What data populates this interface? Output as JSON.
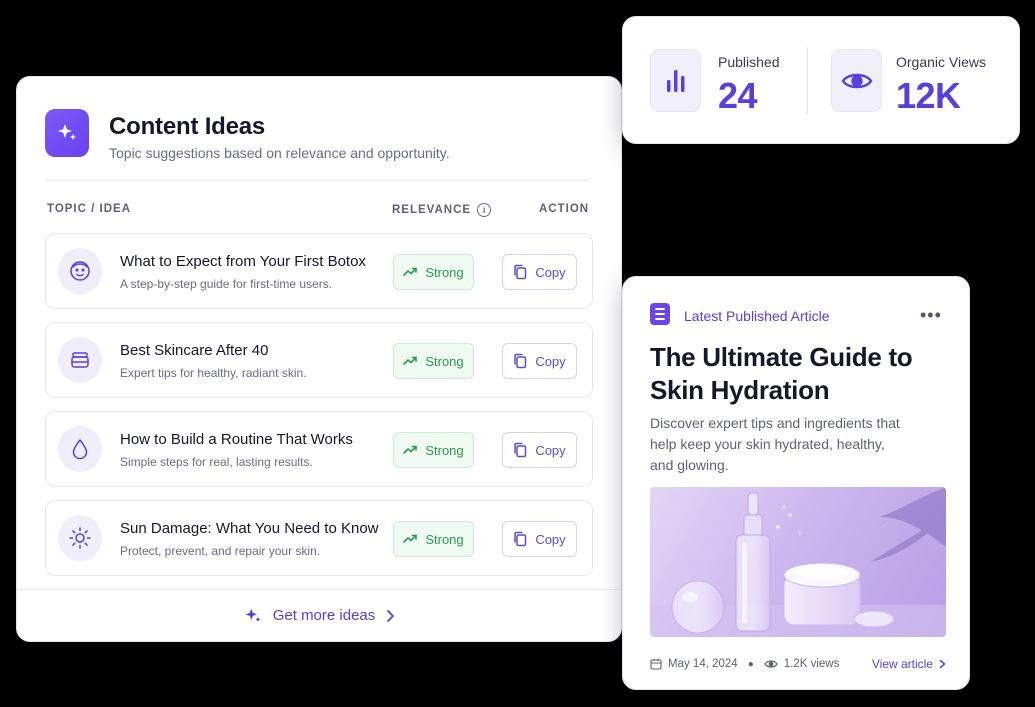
{
  "ideas": {
    "title": "Content Ideas",
    "subtitle": "Topic suggestions based on relevance and opportunity.",
    "columns": {
      "topic": "TOPIC / IDEA",
      "relevance": "RELEVANCE",
      "action": "ACTION"
    },
    "rows": [
      {
        "icon": "face-icon",
        "title": "What to Expect from Your First Botox",
        "desc": "A step-by-step guide for first-time users.",
        "relevance": "Strong",
        "action": "Copy"
      },
      {
        "icon": "jar-icon",
        "title": "Best Skincare After 40",
        "desc": "Expert tips for healthy, radiant skin.",
        "relevance": "Strong",
        "action": "Copy"
      },
      {
        "icon": "drop-icon",
        "title": "How to Build a Routine That Works",
        "desc": "Simple steps for real, lasting results.",
        "relevance": "Strong",
        "action": "Copy"
      },
      {
        "icon": "sun-icon",
        "title": "Sun Damage: What You Need to Know",
        "desc": "Protect, prevent, and repair your skin.",
        "relevance": "Strong",
        "action": "Copy"
      }
    ],
    "footer_label": "Get more ideas"
  },
  "stats": {
    "published_label": "Published",
    "published_value": "24",
    "views_label": "Organic Views",
    "views_value": "12K"
  },
  "article": {
    "kicker": "Latest Published Article",
    "title": "The Ultimate Guide to Skin Hydration",
    "desc": "Discover expert tips and ingredients that help keep your skin hydrated, healthy, and glowing.",
    "date": "May 14, 2024",
    "views": "1.2K views",
    "link": "View article"
  },
  "colors": {
    "accent": "#5a3fdc",
    "success": "#2e9a51",
    "success_bg": "#effaf2",
    "icon_bg": "#efeefa"
  }
}
